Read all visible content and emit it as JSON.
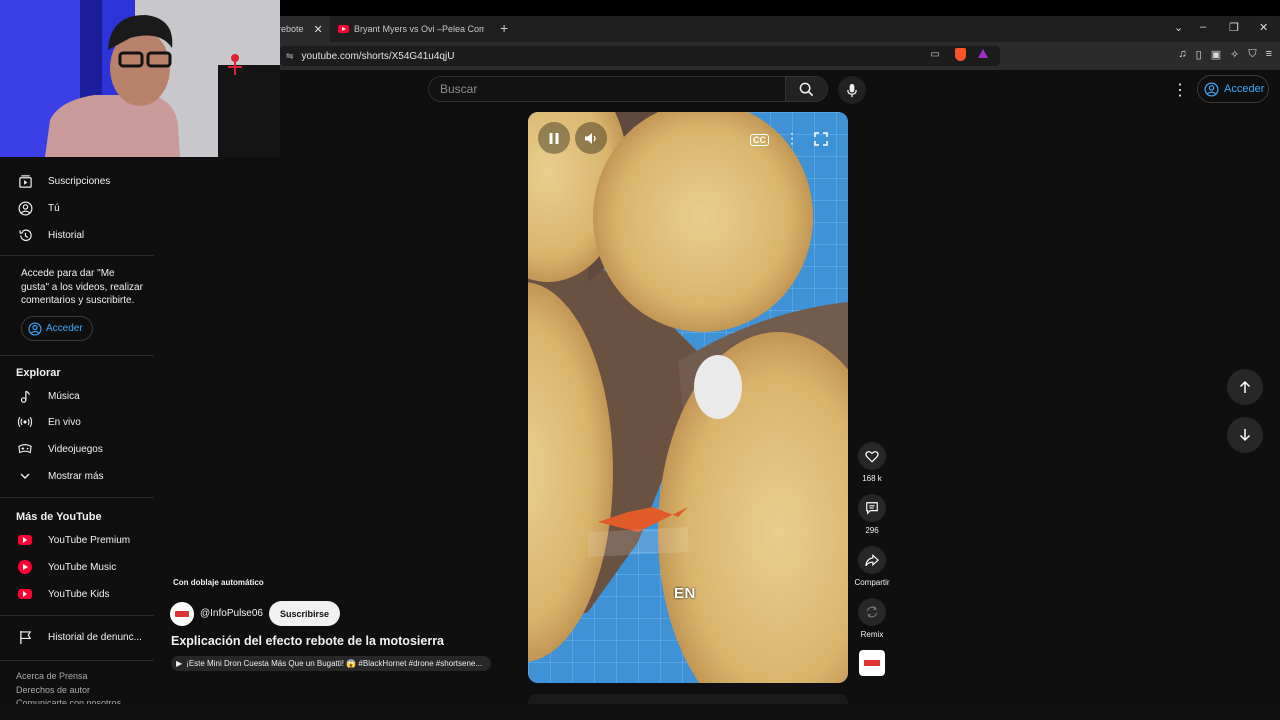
{
  "browser": {
    "active_tab_fragment": "rebote",
    "tab2_title": "Bryant Myers vs Ovi –Pelea Completa",
    "url": "youtube.com/shorts/X54G41u4qjU"
  },
  "header": {
    "search_placeholder": "Buscar",
    "sign_in": "Acceder"
  },
  "sidebar": {
    "items": [
      {
        "label": "Suscripciones",
        "icon": "subscriptions-icon"
      },
      {
        "label": "Tú",
        "icon": "account-icon"
      },
      {
        "label": "Historial",
        "icon": "history-icon"
      }
    ],
    "signin_prompt": "Accede para dar \"Me gusta\" a los videos, realizar comentarios y suscribirte.",
    "signin_button": "Acceder",
    "explore_heading": "Explorar",
    "explore_items": [
      {
        "label": "Música",
        "icon": "music-note-icon"
      },
      {
        "label": "En vivo",
        "icon": "live-icon"
      },
      {
        "label": "Videojuegos",
        "icon": "gaming-icon"
      },
      {
        "label": "Mostrar más",
        "icon": "chevron-down-icon"
      }
    ],
    "more_heading": "Más de YouTube",
    "more_items": [
      {
        "label": "YouTube Premium",
        "icon": "youtube-premium-icon"
      },
      {
        "label": "YouTube Music",
        "icon": "youtube-music-icon"
      },
      {
        "label": "YouTube Kids",
        "icon": "youtube-kids-icon"
      }
    ],
    "report_history": "Historial de denunc...",
    "footer_line1": "Acerca de  Prensa",
    "footer_line2": "Derechos de autor",
    "footer_line3": "Comunicarte con nosotros"
  },
  "video": {
    "dubbing_label": "Con doblaje automático",
    "channel": "@InfoPulse06",
    "subscribe": "Suscribirse",
    "title": "Explicación del efecto rebote de la motosierra",
    "suggestion": "¡Este Mini Dron Cuesta Más Que un Bugatti! 😱 #BlackHornet #drone #shortsene...",
    "caption_lang": "EN"
  },
  "actions": {
    "likes": "168 k",
    "comments": "296",
    "share": "Compartir",
    "remix": "Remix"
  },
  "colors": {
    "accent_blue": "#3ea6ff",
    "youtube_red": "#ff0033",
    "background": "#0f0f0f"
  }
}
